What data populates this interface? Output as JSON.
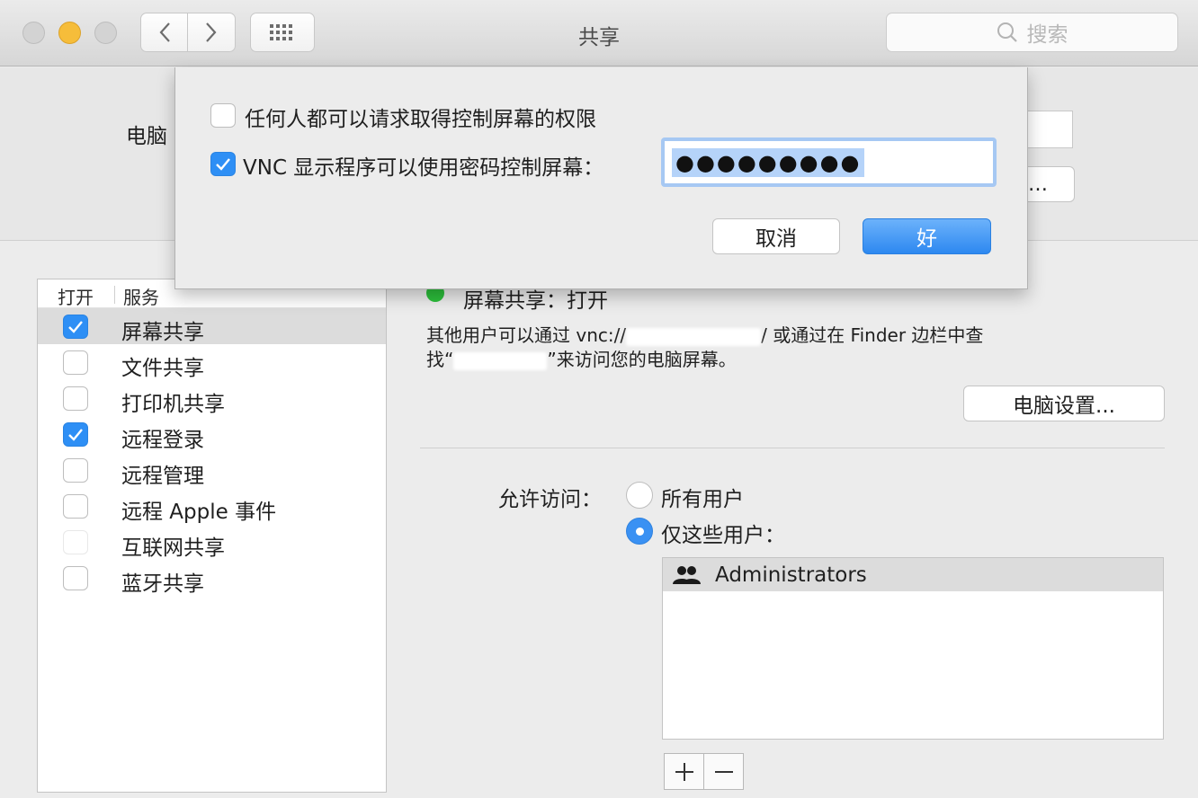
{
  "window": {
    "title": "共享"
  },
  "toolbar": {
    "search_placeholder": "搜索"
  },
  "computer_name": {
    "label": "电脑",
    "edit_button": "…"
  },
  "services": {
    "header_on": "打开",
    "header_service": "服务",
    "items": [
      {
        "label": "屏幕共享",
        "checked": true,
        "selected": true
      },
      {
        "label": "文件共享",
        "checked": false
      },
      {
        "label": "打印机共享",
        "checked": false
      },
      {
        "label": "远程登录",
        "checked": true
      },
      {
        "label": "远程管理",
        "checked": false
      },
      {
        "label": "远程 Apple 事件",
        "checked": false
      },
      {
        "label": "互联网共享",
        "checked": false,
        "disabled": true
      },
      {
        "label": "蓝牙共享",
        "checked": false
      }
    ]
  },
  "detail": {
    "status": "屏幕共享：打开",
    "status_color": "#2cbf3b",
    "desc_part1": "其他用户可以通过 vnc://",
    "desc_part2": "/ 或通过在 Finder 边栏中查",
    "desc_part3": "找“",
    "desc_part4": "”来访问您的电脑屏幕。",
    "computer_settings_button": "电脑设置...",
    "access_label": "允许访问：",
    "radio_all": "所有用户",
    "radio_some": "仅这些用户：",
    "users": [
      "Administrators"
    ]
  },
  "sheet": {
    "option_request": "任何人都可以请求取得控制屏幕的权限",
    "option_request_checked": false,
    "option_vnc": "VNC 显示程序可以使用密码控制屏幕：",
    "option_vnc_checked": true,
    "password_mask": "●●●●●●●●●",
    "cancel_button": "取消",
    "ok_button": "好",
    "accent_color": "#2e8ff5"
  }
}
